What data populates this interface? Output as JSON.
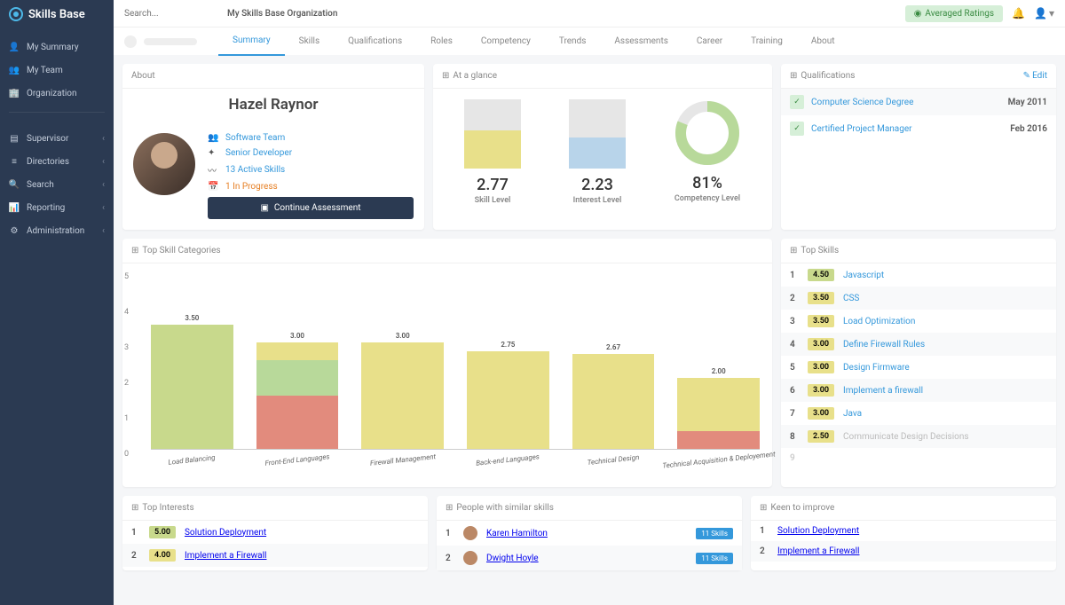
{
  "app": {
    "name": "Skills Base"
  },
  "search": {
    "placeholder": "Search..."
  },
  "org": {
    "title": "My Skills Base Organization"
  },
  "header": {
    "avg_ratings": "Averaged Ratings"
  },
  "sidebar": {
    "items_top": [
      {
        "icon": "person-icon",
        "label": "My Summary"
      },
      {
        "icon": "team-icon",
        "label": "My Team"
      },
      {
        "icon": "org-icon",
        "label": "Organization"
      }
    ],
    "items_bottom": [
      {
        "icon": "supervisor-icon",
        "label": "Supervisor",
        "chev": true
      },
      {
        "icon": "directories-icon",
        "label": "Directories",
        "chev": true
      },
      {
        "icon": "search-icon",
        "label": "Search",
        "chev": true
      },
      {
        "icon": "reporting-icon",
        "label": "Reporting",
        "chev": true
      },
      {
        "icon": "admin-icon",
        "label": "Administration",
        "chev": true
      }
    ]
  },
  "tabs": [
    "Summary",
    "Skills",
    "Qualifications",
    "Roles",
    "Competency",
    "Trends",
    "Assessments",
    "Career",
    "Training",
    "About"
  ],
  "about": {
    "title": "About",
    "name": "Hazel Raynor",
    "team": "Software Team",
    "role": "Senior Developer",
    "active_skills": "13 Active Skills",
    "in_progress": "1 In Progress",
    "continue_btn": "Continue Assessment"
  },
  "glance": {
    "title": "At a glance",
    "metrics": [
      {
        "value": "2.77",
        "label": "Skill Level",
        "fill": 0.55,
        "color": "#e8e08a"
      },
      {
        "value": "2.23",
        "label": "Interest Level",
        "fill": 0.45,
        "color": "#b8d4ea"
      },
      {
        "value": "81%",
        "label": "Competency Level",
        "pct": 81
      }
    ]
  },
  "qualifications": {
    "title": "Qualifications",
    "edit": "Edit",
    "items": [
      {
        "name": "Computer Science Degree",
        "date": "May 2011"
      },
      {
        "name": "Certified Project Manager",
        "date": "Feb 2016"
      }
    ]
  },
  "chart_data": {
    "type": "bar",
    "title": "Top Skill Categories",
    "ylim": [
      0,
      5
    ],
    "yticks": [
      0,
      1,
      2,
      3,
      4,
      5
    ],
    "categories": [
      "Load Balancing",
      "Front-End Languages",
      "Firewall Management",
      "Back-end Languages",
      "Technical Design",
      "Technical Acquisition & Deployement"
    ],
    "values": [
      3.5,
      3.0,
      3.0,
      2.75,
      2.67,
      2.0
    ],
    "stacks": [
      [
        {
          "h": 3.5,
          "c": "#c8d98c"
        }
      ],
      [
        {
          "h": 1.5,
          "c": "#e28b7d"
        },
        {
          "h": 1.0,
          "c": "#b8d99a"
        },
        {
          "h": 0.5,
          "c": "#e8e08a"
        }
      ],
      [
        {
          "h": 3.0,
          "c": "#e8e08a"
        }
      ],
      [
        {
          "h": 2.75,
          "c": "#e8e08a"
        }
      ],
      [
        {
          "h": 2.67,
          "c": "#e8e08a"
        }
      ],
      [
        {
          "h": 0.5,
          "c": "#e28b7d"
        },
        {
          "h": 1.5,
          "c": "#e8e08a"
        }
      ]
    ]
  },
  "topskills": {
    "title": "Top Skills",
    "items": [
      {
        "rank": 1,
        "score": "4.50",
        "color": "#c8d98c",
        "name": "Javascript"
      },
      {
        "rank": 2,
        "score": "3.50",
        "color": "#e8e08a",
        "name": "CSS"
      },
      {
        "rank": 3,
        "score": "3.50",
        "color": "#e8e08a",
        "name": "Load Optimization"
      },
      {
        "rank": 4,
        "score": "3.00",
        "color": "#e8e08a",
        "name": "Define Firewall Rules"
      },
      {
        "rank": 5,
        "score": "3.00",
        "color": "#e8e08a",
        "name": "Design Firmware"
      },
      {
        "rank": 6,
        "score": "3.00",
        "color": "#e8e08a",
        "name": "Implement a firewall"
      },
      {
        "rank": 7,
        "score": "3.00",
        "color": "#e8e08a",
        "name": "Java"
      },
      {
        "rank": 8,
        "score": "2.50",
        "color": "#e8e08a",
        "name": "Communicate Design Decisions",
        "muted": true
      }
    ]
  },
  "top_interests": {
    "title": "Top Interests",
    "items": [
      {
        "rank": 1,
        "score": "5.00",
        "color": "#c8d98c",
        "name": "Solution Deployment"
      },
      {
        "rank": 2,
        "score": "4.00",
        "color": "#e8e08a",
        "name": "Implement a Firewall"
      }
    ]
  },
  "people": {
    "title": "People with similar skills",
    "items": [
      {
        "rank": 1,
        "name": "Karen Hamilton",
        "count": "11 Skills"
      },
      {
        "rank": 2,
        "name": "Dwight Hoyle",
        "count": "11 Skills"
      }
    ]
  },
  "keen": {
    "title": "Keen to improve",
    "items": [
      {
        "rank": 1,
        "name": "Solution Deployment"
      },
      {
        "rank": 2,
        "name": "Implement a Firewall"
      }
    ]
  }
}
